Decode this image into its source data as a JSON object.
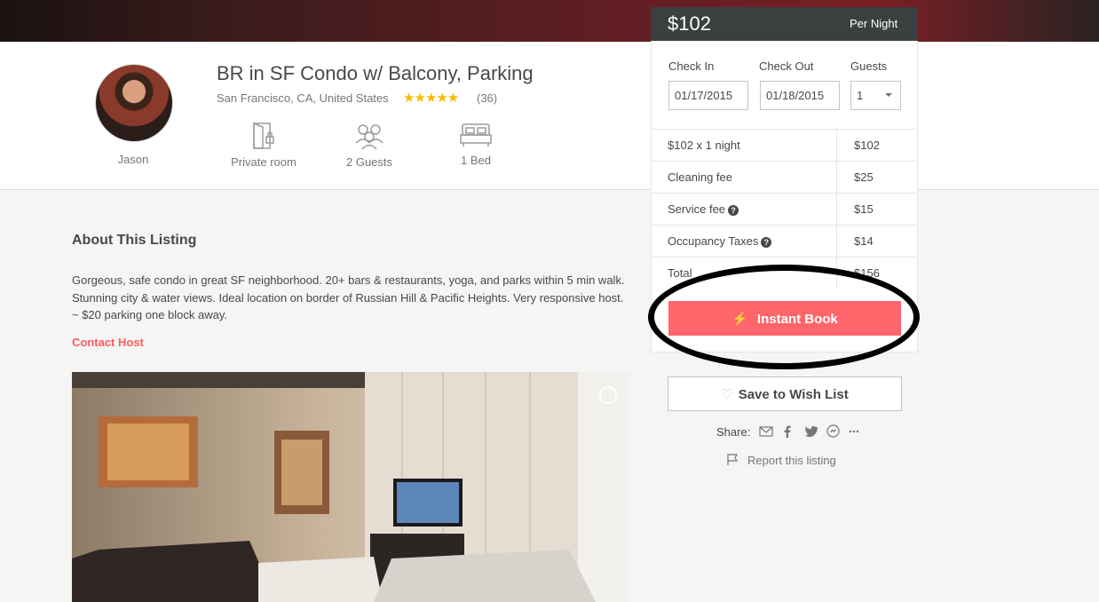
{
  "listing": {
    "title": "BR in SF Condo w/ Balcony, Parking",
    "location": "San Francisco, CA, United States",
    "stars": "★★★★★",
    "reviews": "(36)",
    "host_name": "Jason",
    "features": [
      {
        "icon": "door-icon",
        "label": "Private room"
      },
      {
        "icon": "guests-icon",
        "label": "2 Guests"
      },
      {
        "icon": "bed-icon",
        "label": "1 Bed"
      }
    ]
  },
  "booking": {
    "price": "$102",
    "per_night": "Per Night",
    "check_in_label": "Check In",
    "check_out_label": "Check Out",
    "guests_label": "Guests",
    "check_in": "01/17/2015",
    "check_out": "01/18/2015",
    "guests": "1",
    "fees": [
      {
        "label": "$102 x 1 night",
        "value": "$102"
      },
      {
        "label": "Cleaning fee",
        "value": "$25"
      },
      {
        "label": "Service fee",
        "value": "$15"
      },
      {
        "label": "Occupancy Taxes",
        "value": "$14"
      },
      {
        "label": "Total",
        "value": "$156"
      }
    ],
    "help_glyph": "?",
    "instant_book": "Instant Book",
    "bolt": "⚡",
    "save_wishlist": "Save to Wish List",
    "heart": "♡",
    "share_label": "Share:",
    "report": "Report this listing"
  },
  "about": {
    "title": "About This Listing",
    "description": "Gorgeous, safe condo in great SF neighborhood. 20+ bars & restaurants, yoga, and parks within 5 min walk. Stunning city & water views. Ideal location on border of Russian Hill & Pacific Heights. Very responsive host. ~ $20 parking one block away.",
    "contact": "Contact Host"
  },
  "colors": {
    "accent": "#ff5a5f",
    "price_bar": "#3c3f40",
    "star": "#fcb900"
  }
}
